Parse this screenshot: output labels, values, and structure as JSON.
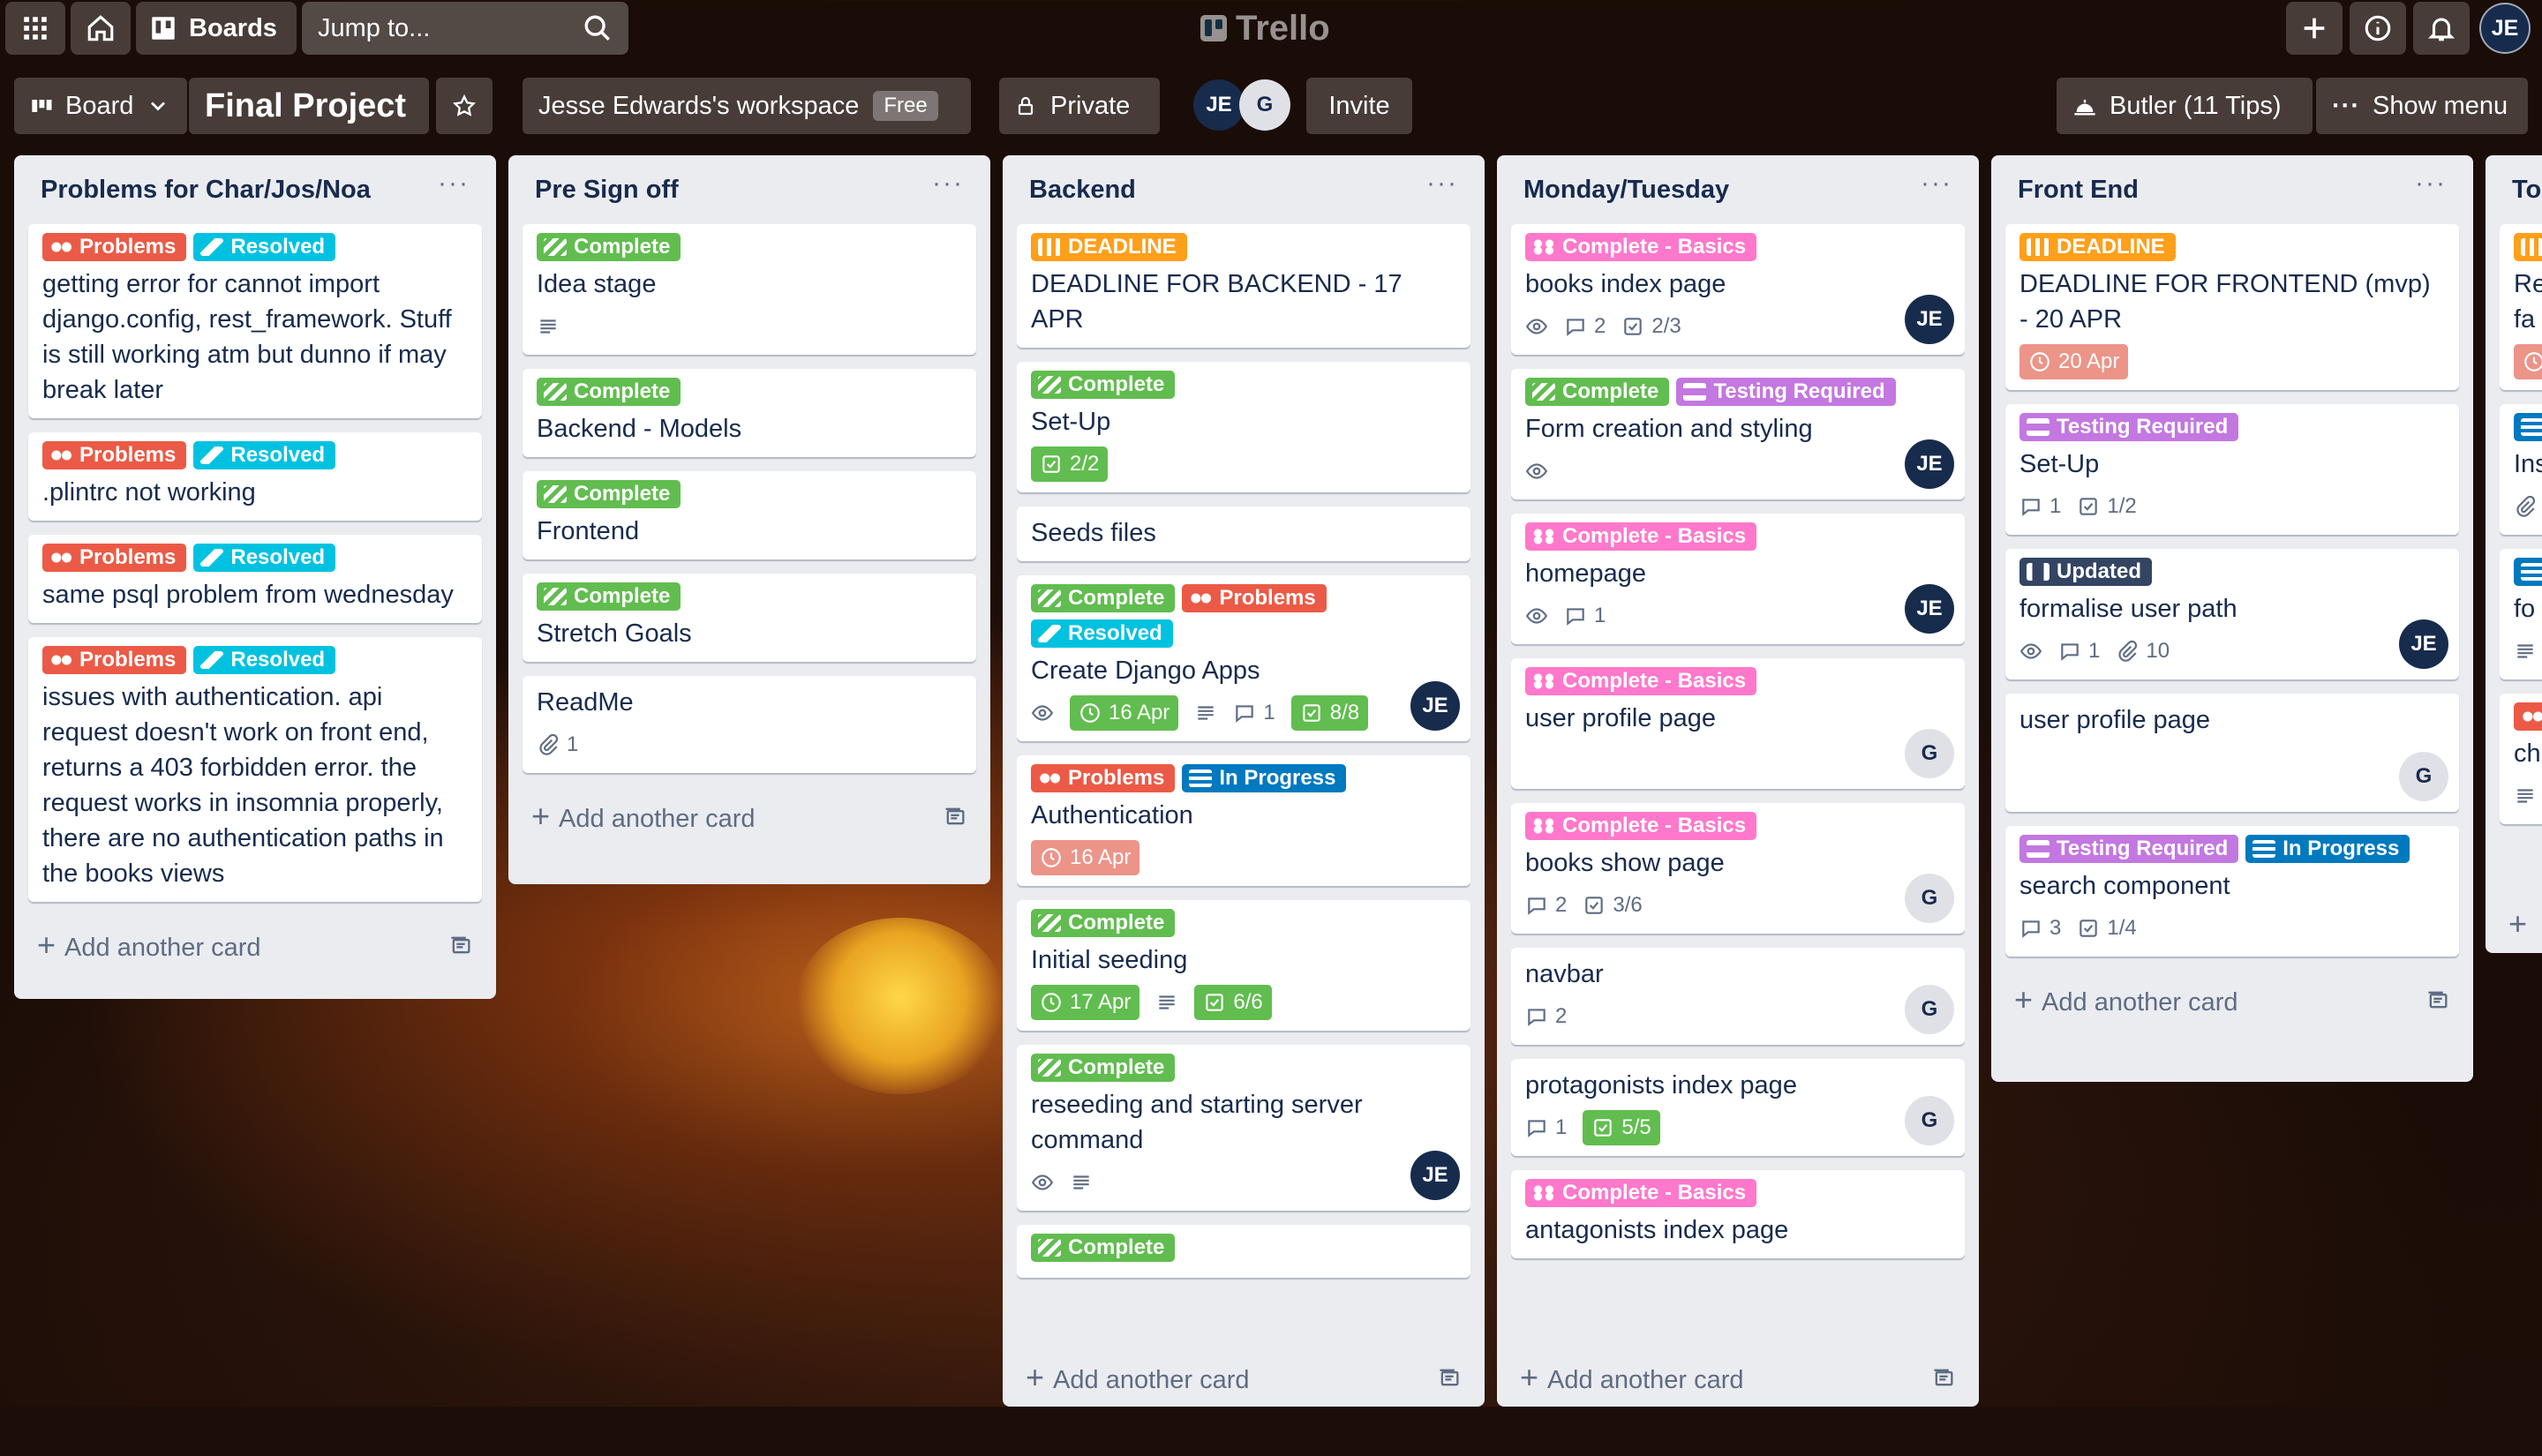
{
  "topbar": {
    "jump_placeholder": "Jump to...",
    "boards_label": "Boards",
    "logo_text": "Trello",
    "user_initials": "JE"
  },
  "board": {
    "view_label": "Board",
    "title": "Final Project",
    "workspace": "Jesse Edwards's workspace",
    "workspace_badge": "Free",
    "visibility": "Private",
    "members": [
      "JE",
      "G"
    ],
    "invite_label": "Invite",
    "butler_label": "Butler (11 Tips)",
    "menu_label": "Show menu"
  },
  "lists": [
    {
      "title": "Problems for Char/Jos/Noa",
      "add_label": "Add another card",
      "cards": [
        {
          "labels": [
            {
              "text": "Problems",
              "color": "red"
            },
            {
              "text": "Resolved",
              "color": "sky"
            }
          ],
          "title": "getting error for cannot import django.config, rest_framework. Stuff is still working atm but dunno if may break later"
        },
        {
          "labels": [
            {
              "text": "Problems",
              "color": "red"
            },
            {
              "text": "Resolved",
              "color": "sky"
            }
          ],
          "title": ".plintrc not working"
        },
        {
          "labels": [
            {
              "text": "Problems",
              "color": "red"
            },
            {
              "text": "Resolved",
              "color": "sky"
            }
          ],
          "title": "same psql problem from wednesday"
        },
        {
          "labels": [
            {
              "text": "Problems",
              "color": "red"
            },
            {
              "text": "Resolved",
              "color": "sky"
            }
          ],
          "title": "issues with authentication. api request doesn't work on front end, returns a 403 forbidden error. the request works in insomnia properly, there are no authentication paths in the books views"
        }
      ]
    },
    {
      "title": "Pre Sign off",
      "add_label": "Add another card",
      "cards": [
        {
          "labels": [
            {
              "text": "Complete",
              "color": "green"
            }
          ],
          "title": "Idea stage",
          "badges": [
            {
              "type": "desc"
            }
          ]
        },
        {
          "labels": [
            {
              "text": "Complete",
              "color": "green"
            }
          ],
          "title": "Backend - Models"
        },
        {
          "labels": [
            {
              "text": "Complete",
              "color": "green"
            }
          ],
          "title": "Frontend"
        },
        {
          "labels": [
            {
              "text": "Complete",
              "color": "green"
            }
          ],
          "title": "Stretch Goals"
        },
        {
          "labels": [],
          "title": "ReadMe",
          "badges": [
            {
              "type": "attach",
              "text": "1"
            }
          ]
        }
      ]
    },
    {
      "title": "Backend",
      "add_label": "Add another card",
      "cards": [
        {
          "labels": [
            {
              "text": "DEADLINE",
              "color": "orange"
            }
          ],
          "title": "DEADLINE FOR BACKEND - 17 APR"
        },
        {
          "labels": [
            {
              "text": "Complete",
              "color": "green"
            }
          ],
          "title": "Set-Up",
          "badges": [
            {
              "type": "check",
              "text": "2/2",
              "style": "box"
            }
          ]
        },
        {
          "labels": [],
          "title": "Seeds files"
        },
        {
          "labels": [
            {
              "text": "Complete",
              "color": "green"
            },
            {
              "text": "Problems",
              "color": "red"
            },
            {
              "text": "Resolved",
              "color": "sky"
            }
          ],
          "title": "Create Django Apps",
          "badges": [
            {
              "type": "watch"
            },
            {
              "type": "clock",
              "text": "16 Apr",
              "style": "box"
            },
            {
              "type": "desc"
            },
            {
              "type": "comment",
              "text": "1"
            },
            {
              "type": "check",
              "text": "8/8",
              "style": "box"
            }
          ],
          "member": "JE"
        },
        {
          "labels": [
            {
              "text": "Problems",
              "color": "red"
            },
            {
              "text": "In Progress",
              "color": "blue"
            }
          ],
          "title": "Authentication",
          "badges": [
            {
              "type": "clock",
              "text": "16 Apr",
              "style": "due"
            }
          ]
        },
        {
          "labels": [
            {
              "text": "Complete",
              "color": "green"
            }
          ],
          "title": "Initial seeding",
          "badges": [
            {
              "type": "clock",
              "text": "17 Apr",
              "style": "box"
            },
            {
              "type": "desc"
            },
            {
              "type": "check",
              "text": "6/6",
              "style": "box"
            }
          ]
        },
        {
          "labels": [
            {
              "text": "Complete",
              "color": "green"
            }
          ],
          "title": "reseeding and starting server command",
          "badges": [
            {
              "type": "watch"
            },
            {
              "type": "desc"
            }
          ],
          "member": "JE"
        },
        {
          "labels": [
            {
              "text": "Complete",
              "color": "green"
            }
          ],
          "title": ""
        }
      ]
    },
    {
      "title": "Monday/Tuesday",
      "add_label": "Add another card",
      "cards": [
        {
          "labels": [
            {
              "text": "Complete - Basics",
              "color": "pink"
            }
          ],
          "title": "books index page",
          "badges": [
            {
              "type": "watch"
            },
            {
              "type": "comment",
              "text": "2"
            },
            {
              "type": "check",
              "text": "2/3"
            }
          ],
          "member": "JE"
        },
        {
          "labels": [
            {
              "text": "Complete",
              "color": "green"
            },
            {
              "text": "Testing Required",
              "color": "purple"
            }
          ],
          "title": "Form creation and styling",
          "badges": [
            {
              "type": "watch"
            }
          ],
          "member": "JE"
        },
        {
          "labels": [
            {
              "text": "Complete - Basics",
              "color": "pink"
            }
          ],
          "title": "homepage",
          "badges": [
            {
              "type": "watch"
            },
            {
              "type": "comment",
              "text": "1"
            }
          ],
          "member": "JE"
        },
        {
          "labels": [
            {
              "text": "Complete - Basics",
              "color": "pink"
            }
          ],
          "title": "user profile page",
          "badges": [],
          "member": "G"
        },
        {
          "labels": [
            {
              "text": "Complete - Basics",
              "color": "pink"
            }
          ],
          "title": "books show page",
          "badges": [
            {
              "type": "comment",
              "text": "2"
            },
            {
              "type": "check",
              "text": "3/6"
            }
          ],
          "member": "G"
        },
        {
          "labels": [],
          "title": "navbar",
          "badges": [
            {
              "type": "comment",
              "text": "2"
            }
          ],
          "member": "G"
        },
        {
          "labels": [],
          "title": "protagonists index page",
          "badges": [
            {
              "type": "comment",
              "text": "1"
            },
            {
              "type": "check",
              "text": "5/5",
              "style": "box"
            }
          ],
          "member": "G"
        },
        {
          "labels": [
            {
              "text": "Complete - Basics",
              "color": "pink"
            }
          ],
          "title": "antagonists index page"
        }
      ]
    },
    {
      "title": "Front End",
      "add_label": "Add another card",
      "cards": [
        {
          "labels": [
            {
              "text": "DEADLINE",
              "color": "orange"
            }
          ],
          "title": "DEADLINE FOR FRONTEND (mvp) - 20 APR",
          "badges": [
            {
              "type": "clock",
              "text": "20 Apr",
              "style": "due"
            }
          ]
        },
        {
          "labels": [
            {
              "text": "Testing Required",
              "color": "purple"
            }
          ],
          "title": "Set-Up",
          "badges": [
            {
              "type": "comment",
              "text": "1"
            },
            {
              "type": "check",
              "text": "1/2"
            }
          ]
        },
        {
          "labels": [
            {
              "text": "Updated",
              "color": "navy"
            }
          ],
          "title": "formalise user path",
          "badges": [
            {
              "type": "watch"
            },
            {
              "type": "comment",
              "text": "1"
            },
            {
              "type": "attach",
              "text": "10"
            }
          ],
          "member": "JE"
        },
        {
          "labels": [],
          "title": "user profile page",
          "badges": [],
          "member": "G"
        },
        {
          "labels": [
            {
              "text": "Testing Required",
              "color": "purple"
            },
            {
              "text": "In Progress",
              "color": "blue"
            }
          ],
          "title": "search component",
          "badges": [
            {
              "type": "comment",
              "text": "3"
            },
            {
              "type": "check",
              "text": "1/4"
            }
          ]
        }
      ]
    },
    {
      "title": "To",
      "add_label": "Add another card",
      "cards": [
        {
          "labels": [
            {
              "text": "",
              "color": "orange"
            }
          ],
          "title": "Re fa",
          "badges": [
            {
              "type": "clock",
              "text": "",
              "style": "due"
            }
          ]
        },
        {
          "labels": [
            {
              "text": "",
              "color": "blue"
            }
          ],
          "title": "Ins",
          "badges": [
            {
              "type": "attach",
              "text": ""
            }
          ]
        },
        {
          "labels": [
            {
              "text": "",
              "color": "blue"
            }
          ],
          "title": "fo",
          "badges": [
            {
              "type": "desc"
            }
          ]
        },
        {
          "labels": [
            {
              "text": "",
              "color": "red"
            }
          ],
          "title": "ch",
          "badges": [
            {
              "type": "desc"
            }
          ]
        }
      ]
    }
  ]
}
